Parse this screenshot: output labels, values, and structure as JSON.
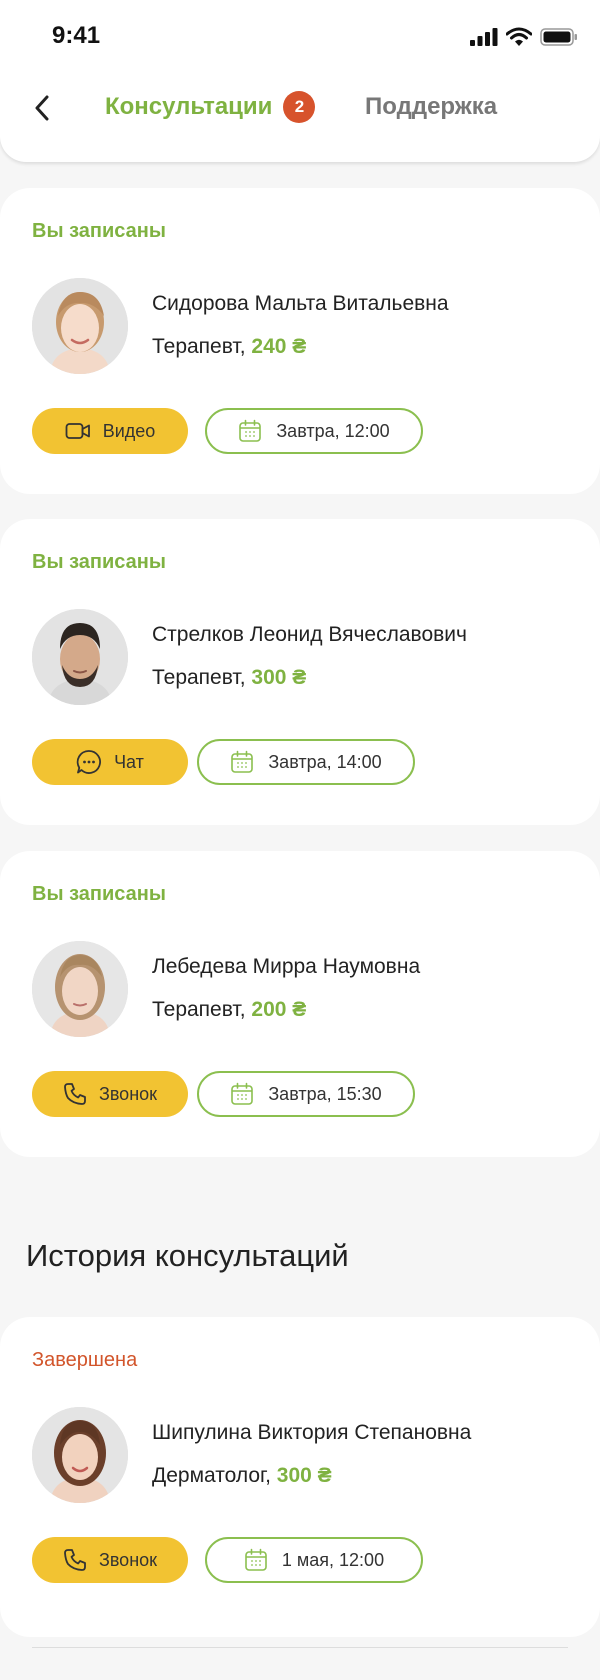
{
  "status_bar": {
    "time": "9:41"
  },
  "tabs": {
    "consultations": {
      "label": "Консультации",
      "badge": "2"
    },
    "support": {
      "label": "Поддержка"
    }
  },
  "active": [
    {
      "status": "Вы записаны",
      "name": "Сидорова Мальта Витальевна",
      "specialty": "Терапевт,",
      "price": "240 ₴",
      "type": {
        "label": "Видео",
        "icon": "video-camera-icon"
      },
      "time": "Завтра, 12:00"
    },
    {
      "status": "Вы записаны",
      "name": "Стрелков Леонид Вячеславович",
      "specialty": "Терапевт,",
      "price": "300 ₴",
      "type": {
        "label": "Чат",
        "icon": "chat-bubble-icon"
      },
      "time": "Завтра, 14:00"
    },
    {
      "status": "Вы записаны",
      "name": "Лебедева Мирра Наумовна",
      "specialty": "Терапевт,",
      "price": "200 ₴",
      "type": {
        "label": "Звонок",
        "icon": "phone-icon"
      },
      "time": "Завтра, 15:30"
    }
  ],
  "history_title": "История консультаций",
  "history": [
    {
      "status": "Завершена",
      "name": "Шипулина Виктория Степановна",
      "specialty": "Дерматолог,",
      "price": "300 ₴",
      "type": {
        "label": "Звонок",
        "icon": "phone-icon"
      },
      "time": "1 мая, 12:00"
    }
  ],
  "colors": {
    "accent_green": "#7fb241",
    "accent_yellow": "#f2c332",
    "badge_red": "#d7532c",
    "completed_status": "#d2552b",
    "background": "#f6f6f6"
  }
}
